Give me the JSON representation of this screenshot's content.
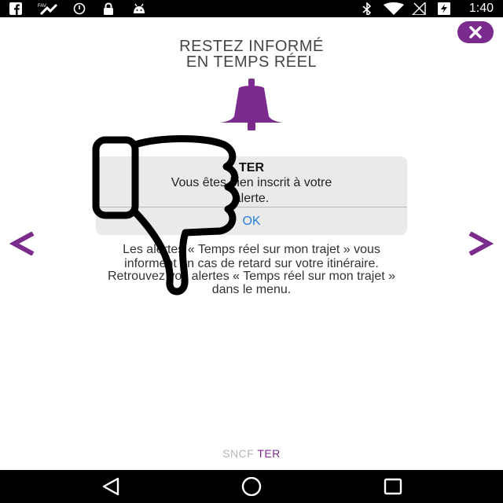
{
  "status_bar": {
    "time": "1:40",
    "left_icons": [
      "facebook-icon",
      "fitness-icon",
      "alarm-icon",
      "lock-icon",
      "android-icon"
    ],
    "right_icons": [
      "bluetooth-icon",
      "wifi-icon",
      "signal-icon",
      "battery-icon"
    ]
  },
  "header": {
    "title_line1": "RESTEZ INFORMÉ",
    "title_line2": "EN TEMPS RÉEL"
  },
  "dialog": {
    "title": "TER",
    "message_line1": "Vous êtes bien inscrit à votre",
    "message_line2": "alerte.",
    "ok_label": "OK"
  },
  "content": {
    "line1": "Les alertes « Temps réel sur mon trajet » vous",
    "line2": "informent en cas de retard sur votre itinéraire.",
    "line3": "Retrouvez vos alertes « Temps réel sur mon trajet »",
    "line4": "dans le menu."
  },
  "footer": {
    "brand_sncf": "SNCF",
    "brand_ter": "TER"
  },
  "colors": {
    "accent": "#7b2a8e",
    "ok_blue": "#2b7fe0"
  }
}
